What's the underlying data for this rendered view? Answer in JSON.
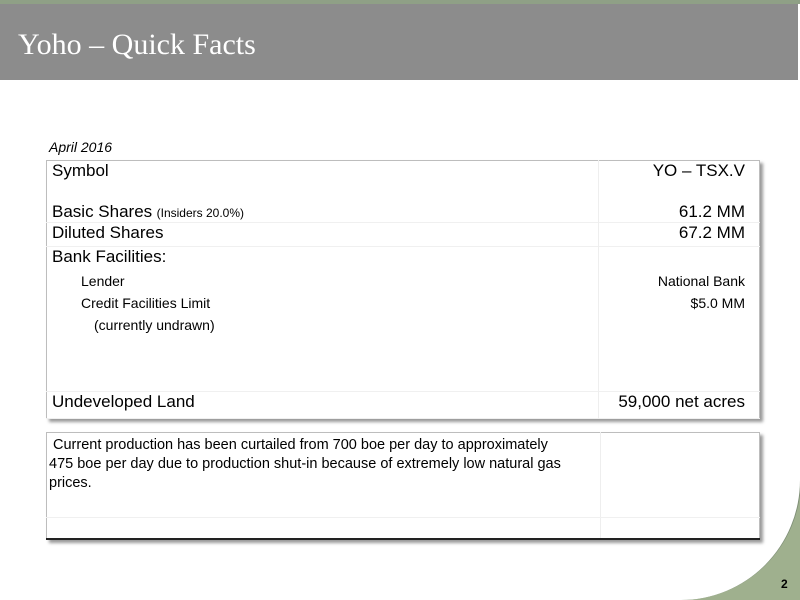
{
  "header": {
    "title": "Yoho – Quick Facts"
  },
  "date": "April 2016",
  "facts": {
    "symbol_label": "Symbol",
    "symbol_value": "YO – TSX.V",
    "basic_shares_label": "Basic Shares",
    "basic_shares_note": "(Insiders 20.0%)",
    "basic_shares_value": "61.2 MM",
    "diluted_shares_label": "Diluted Shares",
    "diluted_shares_value": "67.2 MM",
    "bank_facilities_label": "Bank Facilities:",
    "lender_label": "Lender",
    "lender_value": "National Bank",
    "credit_limit_label": "Credit Facilities Limit",
    "credit_limit_value": "$5.0 MM",
    "credit_limit_note": "(currently undrawn)",
    "undeveloped_land_label": "Undeveloped Land",
    "undeveloped_land_value": "59,000 net acres"
  },
  "note": {
    "line1": "Current production has been curtailed from 700 boe per day to approximately",
    "line2": "475 boe per day due to production shut-in because of extremely low natural gas",
    "line3": "prices."
  },
  "footer": {
    "page_number": "2"
  }
}
